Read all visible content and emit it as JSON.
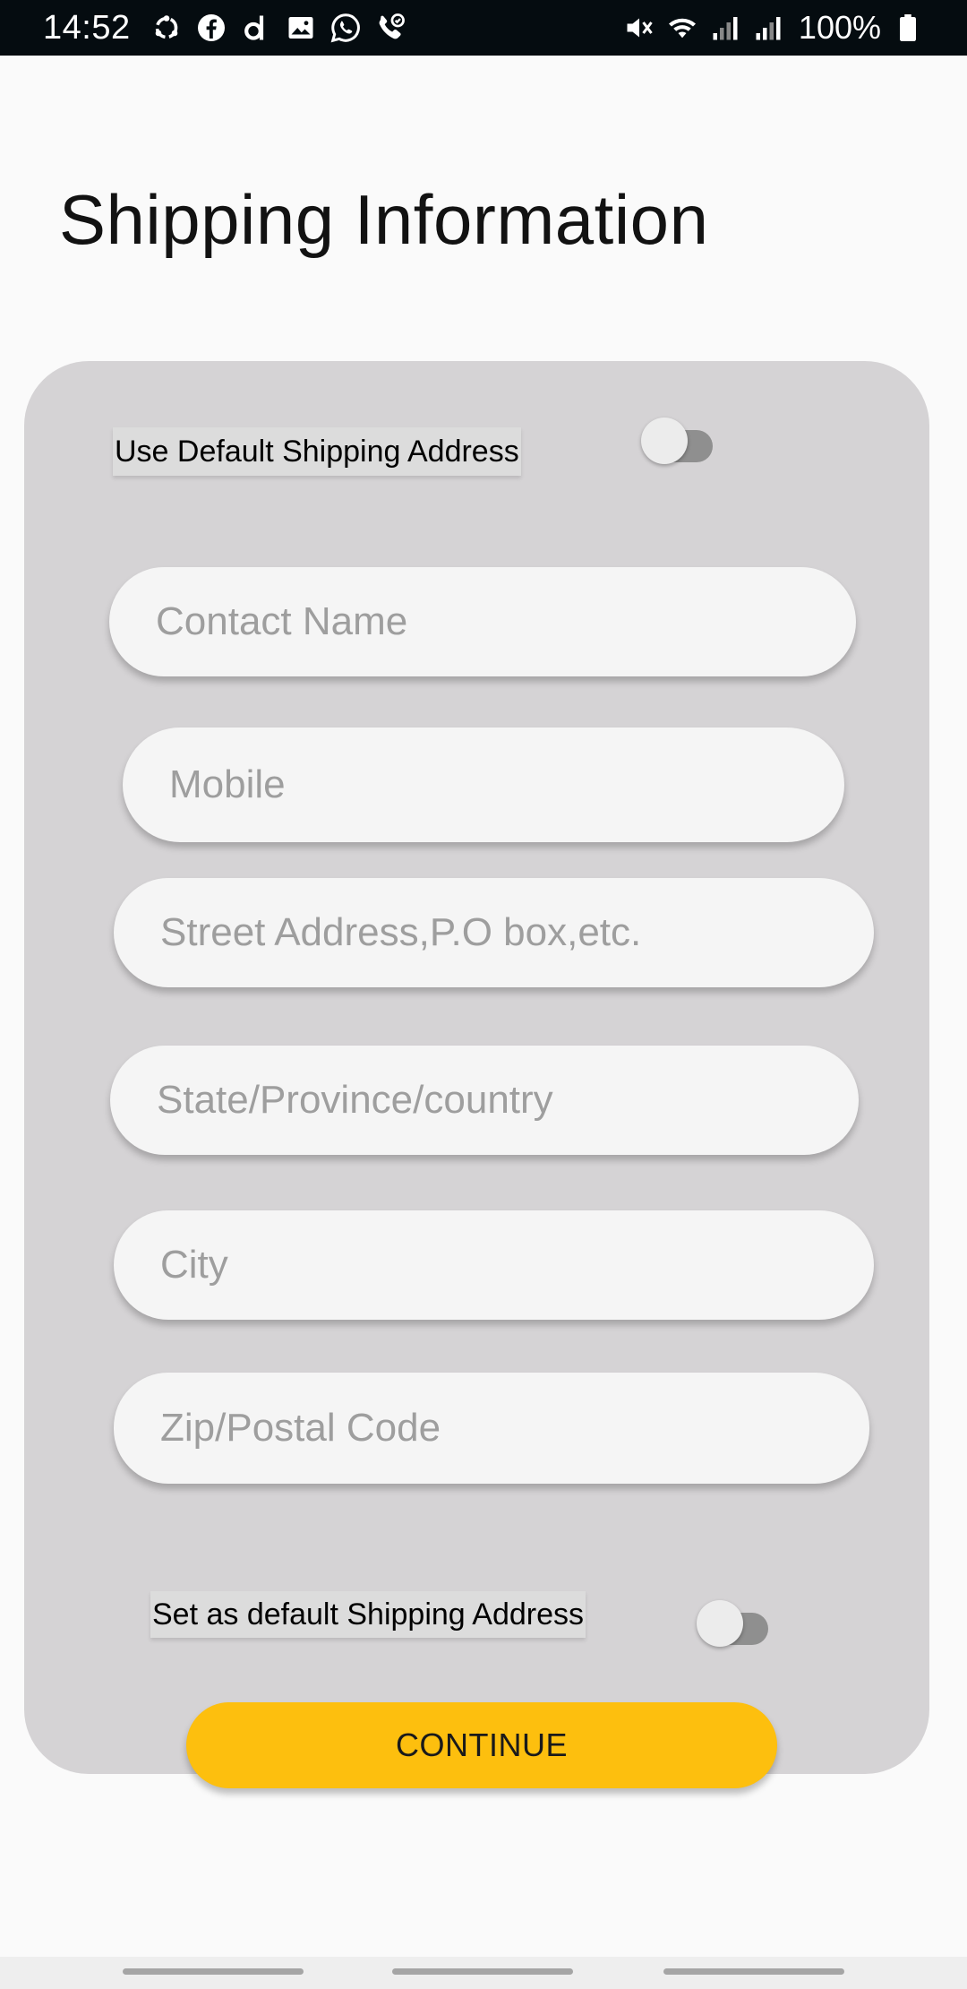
{
  "status_bar": {
    "time": "14:52",
    "left_icons": [
      "sync-icon",
      "facebook-icon",
      "d-app-icon",
      "gallery-icon",
      "whatsapp-icon",
      "call-icon"
    ],
    "right_icons": [
      "mute-icon",
      "wifi-icon",
      "signal-icon",
      "signal-icon-2"
    ],
    "battery": "100%"
  },
  "page": {
    "title": "Shipping Information"
  },
  "form": {
    "use_default_label": "Use Default Shipping Address",
    "use_default_on": false,
    "fields": {
      "contact_name": {
        "placeholder": "Contact Name",
        "value": ""
      },
      "mobile": {
        "placeholder": "Mobile",
        "value": ""
      },
      "street": {
        "placeholder": "Street Address,P.O box,etc.",
        "value": ""
      },
      "state": {
        "placeholder": "State/Province/country",
        "value": ""
      },
      "city": {
        "placeholder": "City",
        "value": ""
      },
      "zip": {
        "placeholder": "Zip/Postal Code",
        "value": ""
      }
    },
    "set_default_label": "Set as default Shipping Address",
    "set_default_on": false,
    "continue_label": "CONTINUE"
  },
  "colors": {
    "status_bar_bg": "#050c10",
    "card_bg": "#d5d3d5",
    "field_bg": "#f5f5f5",
    "accent": "#fdbf0e"
  }
}
